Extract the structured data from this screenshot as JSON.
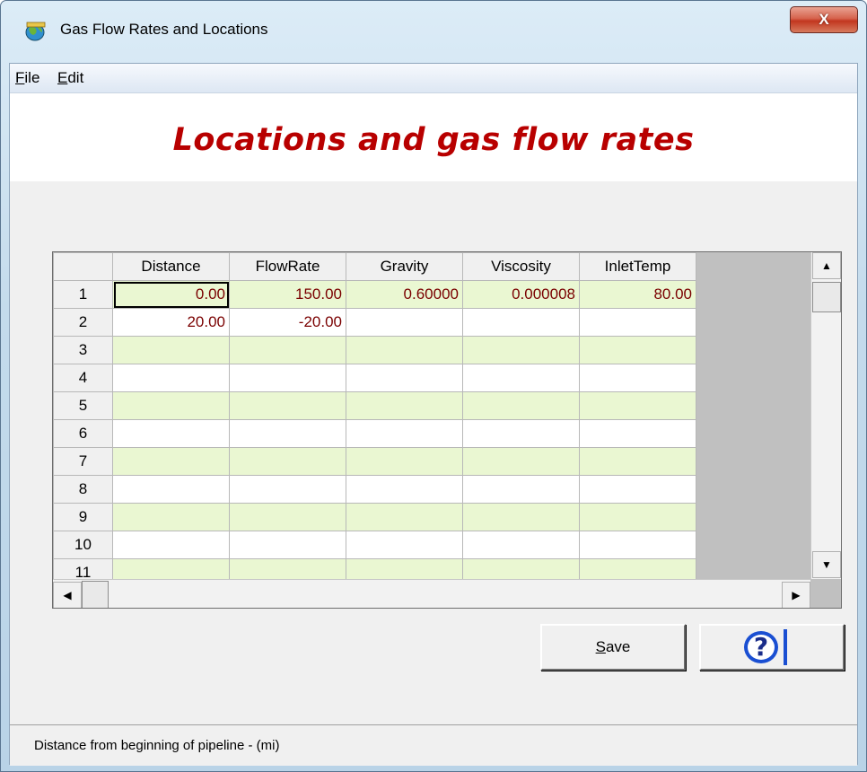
{
  "window": {
    "title": "Gas Flow Rates and Locations",
    "close_label": "X"
  },
  "menu": {
    "items": [
      {
        "label": "File",
        "accel": "F"
      },
      {
        "label": "Edit",
        "accel": "E"
      }
    ]
  },
  "header": {
    "title": "Locations and gas flow rates",
    "title_color": "#b80000"
  },
  "grid": {
    "columns": [
      "Distance",
      "FlowRate",
      "Gravity",
      "Viscosity",
      "InletTemp"
    ],
    "row_numbers": [
      "1",
      "2",
      "3",
      "4",
      "5",
      "6",
      "7",
      "8",
      "9",
      "10",
      "11"
    ],
    "rows": [
      [
        "0.00",
        "150.00",
        "0.60000",
        "0.000008",
        "80.00"
      ],
      [
        "20.00",
        "-20.00",
        "",
        "",
        ""
      ],
      [
        "",
        "",
        "",
        "",
        ""
      ],
      [
        "",
        "",
        "",
        "",
        ""
      ],
      [
        "",
        "",
        "",
        "",
        ""
      ],
      [
        "",
        "",
        "",
        "",
        ""
      ],
      [
        "",
        "",
        "",
        "",
        ""
      ],
      [
        "",
        "",
        "",
        "",
        ""
      ],
      [
        "",
        "",
        "",
        "",
        ""
      ],
      [
        "",
        "",
        "",
        "",
        ""
      ],
      [
        "",
        "",
        "",
        "",
        ""
      ]
    ],
    "selected_cell": {
      "row": 1,
      "column": "Distance"
    },
    "row_colors": {
      "odd": "#eaf7d2",
      "even": "#ffffff"
    },
    "value_color": "#7a0000"
  },
  "buttons": {
    "save_label": "Save",
    "save_accel": "S",
    "help_icon": "help-question-icon",
    "help_glyph": "?"
  },
  "status": {
    "text": "Distance from beginning of pipeline - (mi)"
  }
}
